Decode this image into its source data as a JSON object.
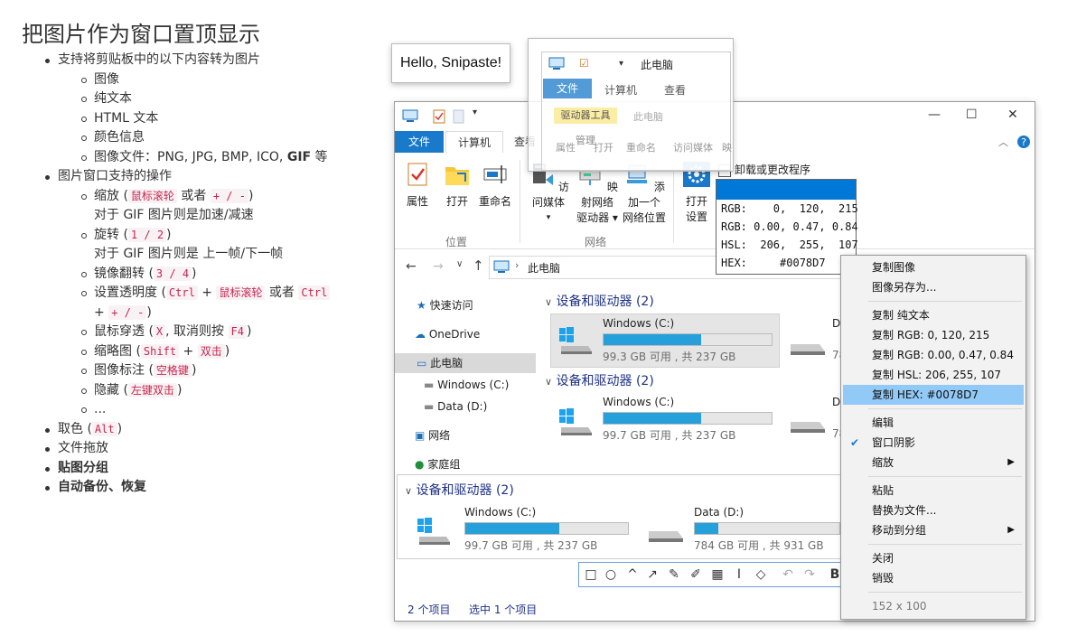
{
  "doc": {
    "title": "把图片作为窗口置顶显示",
    "items": [
      {
        "kind": "b",
        "text": "支持将剪贴板中的以下内容转为图片"
      },
      {
        "kind": "c",
        "text": "图像"
      },
      {
        "kind": "c",
        "text": "纯文本"
      },
      {
        "kind": "c",
        "text": "HTML 文本"
      },
      {
        "kind": "c",
        "text": "颜色信息"
      },
      {
        "kind": "c",
        "text": "图像文件：PNG, JPG, BMP, ICO, ",
        "bold": "GIF",
        "tail": " 等"
      },
      {
        "kind": "b",
        "text": "图片窗口支持的操作"
      }
    ],
    "ops": {
      "zoom": {
        "t1": "缩放 (",
        "k1": "鼠标滚轮",
        "t2": " 或者 ",
        "k2": "+ / -",
        "t3": ")",
        "sub": "对于 GIF 图片则是加速/减速"
      },
      "rotate": {
        "t1": "旋转 (",
        "k1": "1 / 2",
        "t3": ")",
        "sub": "对于 GIF 图片则是 上一帧/下一帧"
      },
      "flip": {
        "t1": "镜像翻转 (",
        "k1": "3 / 4",
        "t3": ")"
      },
      "opacity": {
        "t1": "设置透明度 (",
        "k1": "Ctrl",
        "t2": " + ",
        "k2": "鼠标滚轮",
        "t3": " 或者 ",
        "k3": "Ctrl",
        "t4": " + ",
        "k4": "+ / -",
        "t5": ")"
      },
      "passthrough": {
        "t1": "鼠标穿透 (",
        "k1": "X",
        "t2": ", 取消则按 ",
        "k2": "F4",
        "t3": ")"
      },
      "thumb": {
        "t1": "缩略图 (",
        "k1": "Shift",
        "t2": " + ",
        "k2": "双击",
        "t3": ")"
      },
      "annotate": {
        "t1": "图像标注 (",
        "k1": "空格键",
        "t3": ")"
      },
      "hide": {
        "t1": "隐藏 (",
        "k1": "左键双击",
        "t3": ")"
      },
      "more": "..."
    },
    "tail": {
      "pick": {
        "t1": "取色 (",
        "k1": "Alt",
        "t3": ")"
      },
      "drag": "文件拖放",
      "group": "贴图分组",
      "backup": "自动备份、恢复"
    }
  },
  "hello": "Hello, Snipaste!",
  "snip_top": {
    "title": "此电脑",
    "tabs": [
      "文件",
      "计算机",
      "查看"
    ],
    "tool_tab": "驱动器工具",
    "tool_sub": "管理",
    "title2": "此电脑",
    "buttons": [
      "属性",
      "打开",
      "重命名",
      "访问媒体",
      "映"
    ]
  },
  "explorer": {
    "tabs": {
      "file": "文件",
      "computer": "计算机",
      "view": "查看"
    },
    "ribbon": {
      "props": "属性",
      "open": "打开",
      "rename": "重命名",
      "media": "访问媒体",
      "map1": "映射网络",
      "map2": "驱动器",
      "addnet1": "添加一个",
      "addnet2": "网络位置",
      "open_settings1": "打开",
      "open_settings2": "设置",
      "uninstall": "卸载或更改程序",
      "g_location": "位置",
      "g_network": "网络"
    },
    "address": "此电脑",
    "nav": {
      "quick": "快速访问",
      "onedrive": "OneDrive",
      "thispc": "此电脑",
      "winc": "Windows (C:)",
      "datad": "Data (D:)",
      "network": "网络",
      "homegroup": "家庭组"
    },
    "section_title": "设备和驱动器 (2)",
    "drive_c": {
      "name": "Windows (C:)",
      "free_a": "99.3 GB 可用 , 共 237 GB",
      "free_b": "99.7 GB 可用 , 共 237 GB",
      "used_fraction": 0.58
    },
    "drive_d": {
      "name": "Data (D:)",
      "name_short": "D",
      "free": "784 GB 可用 , 共 931 GB",
      "used_fraction": 0.16,
      "free_short": "78"
    },
    "status": {
      "count": "2 个项目",
      "selected": "选中 1 个项目"
    }
  },
  "color_info": {
    "hex_color": "#0078D7",
    "rgb": "RGB:    0,  120,  215",
    "rgbf": "RGB: 0.00, 0.47, 0.84",
    "hsl": "HSL:  206,  255,  107",
    "hex": "HEX:     #0078D7"
  },
  "menu": {
    "copy_image": "复制图像",
    "save_as": "图像另存为...",
    "copy_text": "复制 纯文本",
    "copy_rgb": "复制 RGB: 0, 120, 215",
    "copy_rgbf": "复制 RGB: 0.00, 0.47, 0.84",
    "copy_hsl": "复制 HSL: 206, 255, 107",
    "copy_hex": "复制 HEX: #0078D7",
    "edit": "编辑",
    "shadow": "窗口阴影",
    "zoom": "缩放",
    "paste": "粘贴",
    "replace": "替换为文件...",
    "move_group": "移动到分组",
    "close": "关闭",
    "destroy": "销毁",
    "size": "152 x 100"
  },
  "icons": [
    "computer-icon",
    "checkbox-icon",
    "folder-icon",
    "check-mark-icon",
    "gear-icon",
    "windows-logo-icon",
    "drive-icon",
    "star-icon",
    "cloud-icon",
    "network-icon",
    "homegroup-icon",
    "help-icon"
  ]
}
